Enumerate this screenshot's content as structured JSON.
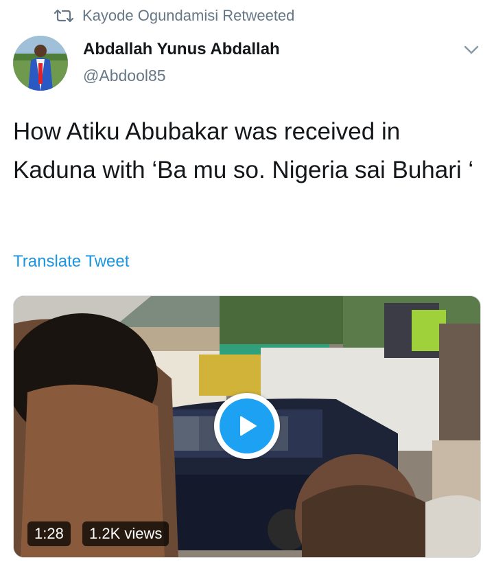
{
  "retweet": {
    "icon": "retweet-icon",
    "text": "Kayode Ogundamisi Retweeted"
  },
  "author": {
    "name": "Abdallah Yunus Abdallah",
    "handle": "@Abdool85",
    "avatar_icon": "avatar"
  },
  "menu": {
    "icon": "chevron-down-icon"
  },
  "tweet": {
    "text": "How Atiku Abubakar was received in Kaduna with ‘Ba mu so. Nigeria sai Buhari ‘"
  },
  "translate": {
    "label": "Translate Tweet"
  },
  "video": {
    "play_icon": "play-icon",
    "duration": "1:28",
    "views": "1.2K views"
  },
  "colors": {
    "text": "#14171a",
    "secondary": "#657786",
    "link": "#1b95e0",
    "play": "#1da1f2"
  }
}
